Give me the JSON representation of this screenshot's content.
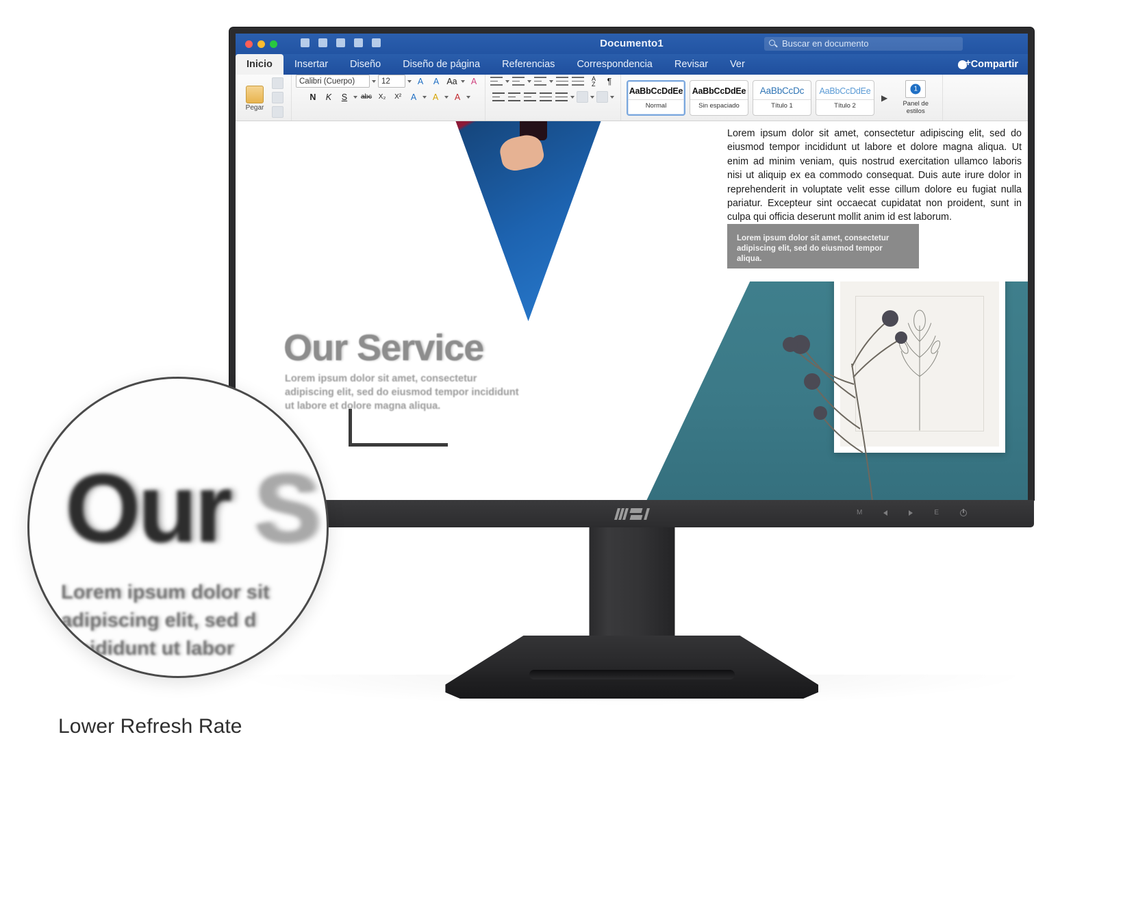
{
  "caption": "Lower Refresh Rate",
  "monitor": {
    "brand": "MSI",
    "osd_buttons": [
      {
        "name": "menu",
        "label": "M"
      },
      {
        "name": "left",
        "label": ""
      },
      {
        "name": "right",
        "label": ""
      },
      {
        "name": "exit",
        "label": "E"
      },
      {
        "name": "power",
        "label": ""
      }
    ]
  },
  "magnifier": {
    "title_dark": "Our",
    "title_faded": "S",
    "line1": "Lorem ipsum dolor sit",
    "line2": "adipiscing elit, sed d",
    "line3": "incididunt ut labor"
  },
  "slide": {
    "title": "Our Service",
    "subtitle": "Lorem ipsum dolor sit amet, consectetur adipiscing elit, sed do eiusmod tempor incididunt ut labore et dolore magna aliqua."
  },
  "word": {
    "title": "Documento1",
    "search_placeholder": "Buscar en documento",
    "share_label": "Compartir",
    "tabs": [
      {
        "label": "Inicio",
        "active": true
      },
      {
        "label": "Insertar",
        "active": false
      },
      {
        "label": "Diseño",
        "active": false
      },
      {
        "label": "Diseño de página",
        "active": false
      },
      {
        "label": "Referencias",
        "active": false
      },
      {
        "label": "Correspondencia",
        "active": false
      },
      {
        "label": "Revisar",
        "active": false
      },
      {
        "label": "Ver",
        "active": false
      }
    ],
    "clipboard": {
      "paste_label": "Pegar"
    },
    "font": {
      "family": "Calibri (Cuerpo)",
      "size": "12",
      "grow_label": "A",
      "shrink_label": "A",
      "case_label": "Aa",
      "clear_label": "A",
      "bold_label": "N",
      "italic_label": "K",
      "underline_label": "S",
      "strike_label": "abc",
      "subscript_label": "X₂",
      "superscript_label": "X²",
      "text_effects_label": "A",
      "highlight_label": "A",
      "font_color_label": "A"
    },
    "paragraph": {
      "sort_label": "A\nZ",
      "marks_label": "¶"
    },
    "styles": {
      "items": [
        {
          "sample": "AaBbCcDdEe",
          "label": "Normal",
          "selected": true
        },
        {
          "sample": "AaBbCcDdEe",
          "label": "Sin espaciado",
          "selected": false
        },
        {
          "sample": "AaBbCcDc",
          "label": "Título 1",
          "selected": false
        },
        {
          "sample": "AaBbCcDdEe",
          "label": "Título 2",
          "selected": false
        }
      ],
      "more_label": "▶",
      "pane_label": "Panel de estilos"
    },
    "document": {
      "paragraph": "Lorem ipsum dolor sit amet, consectetur adipiscing elit, sed do eiusmod tempor incididunt ut labore et dolore magna aliqua. Ut enim ad minim veniam, quis nostrud exercitation ullamco laboris nisi ut aliquip ex ea commodo consequat. Duis aute irure dolor in reprehenderit in voluptate velit esse cillum dolore eu fugiat nulla pariatur. Excepteur sint occaecat cupidatat non proident, sunt in culpa qui officia deserunt mollit anim id est laborum.",
      "callout": "Lorem ipsum dolor sit amet, consectetur adipiscing elit, sed do eiusmod tempor aliqua."
    }
  },
  "colors": {
    "word_blue": "#2254a3",
    "bezel": "#343436",
    "accent_teal": "#3b7987"
  }
}
